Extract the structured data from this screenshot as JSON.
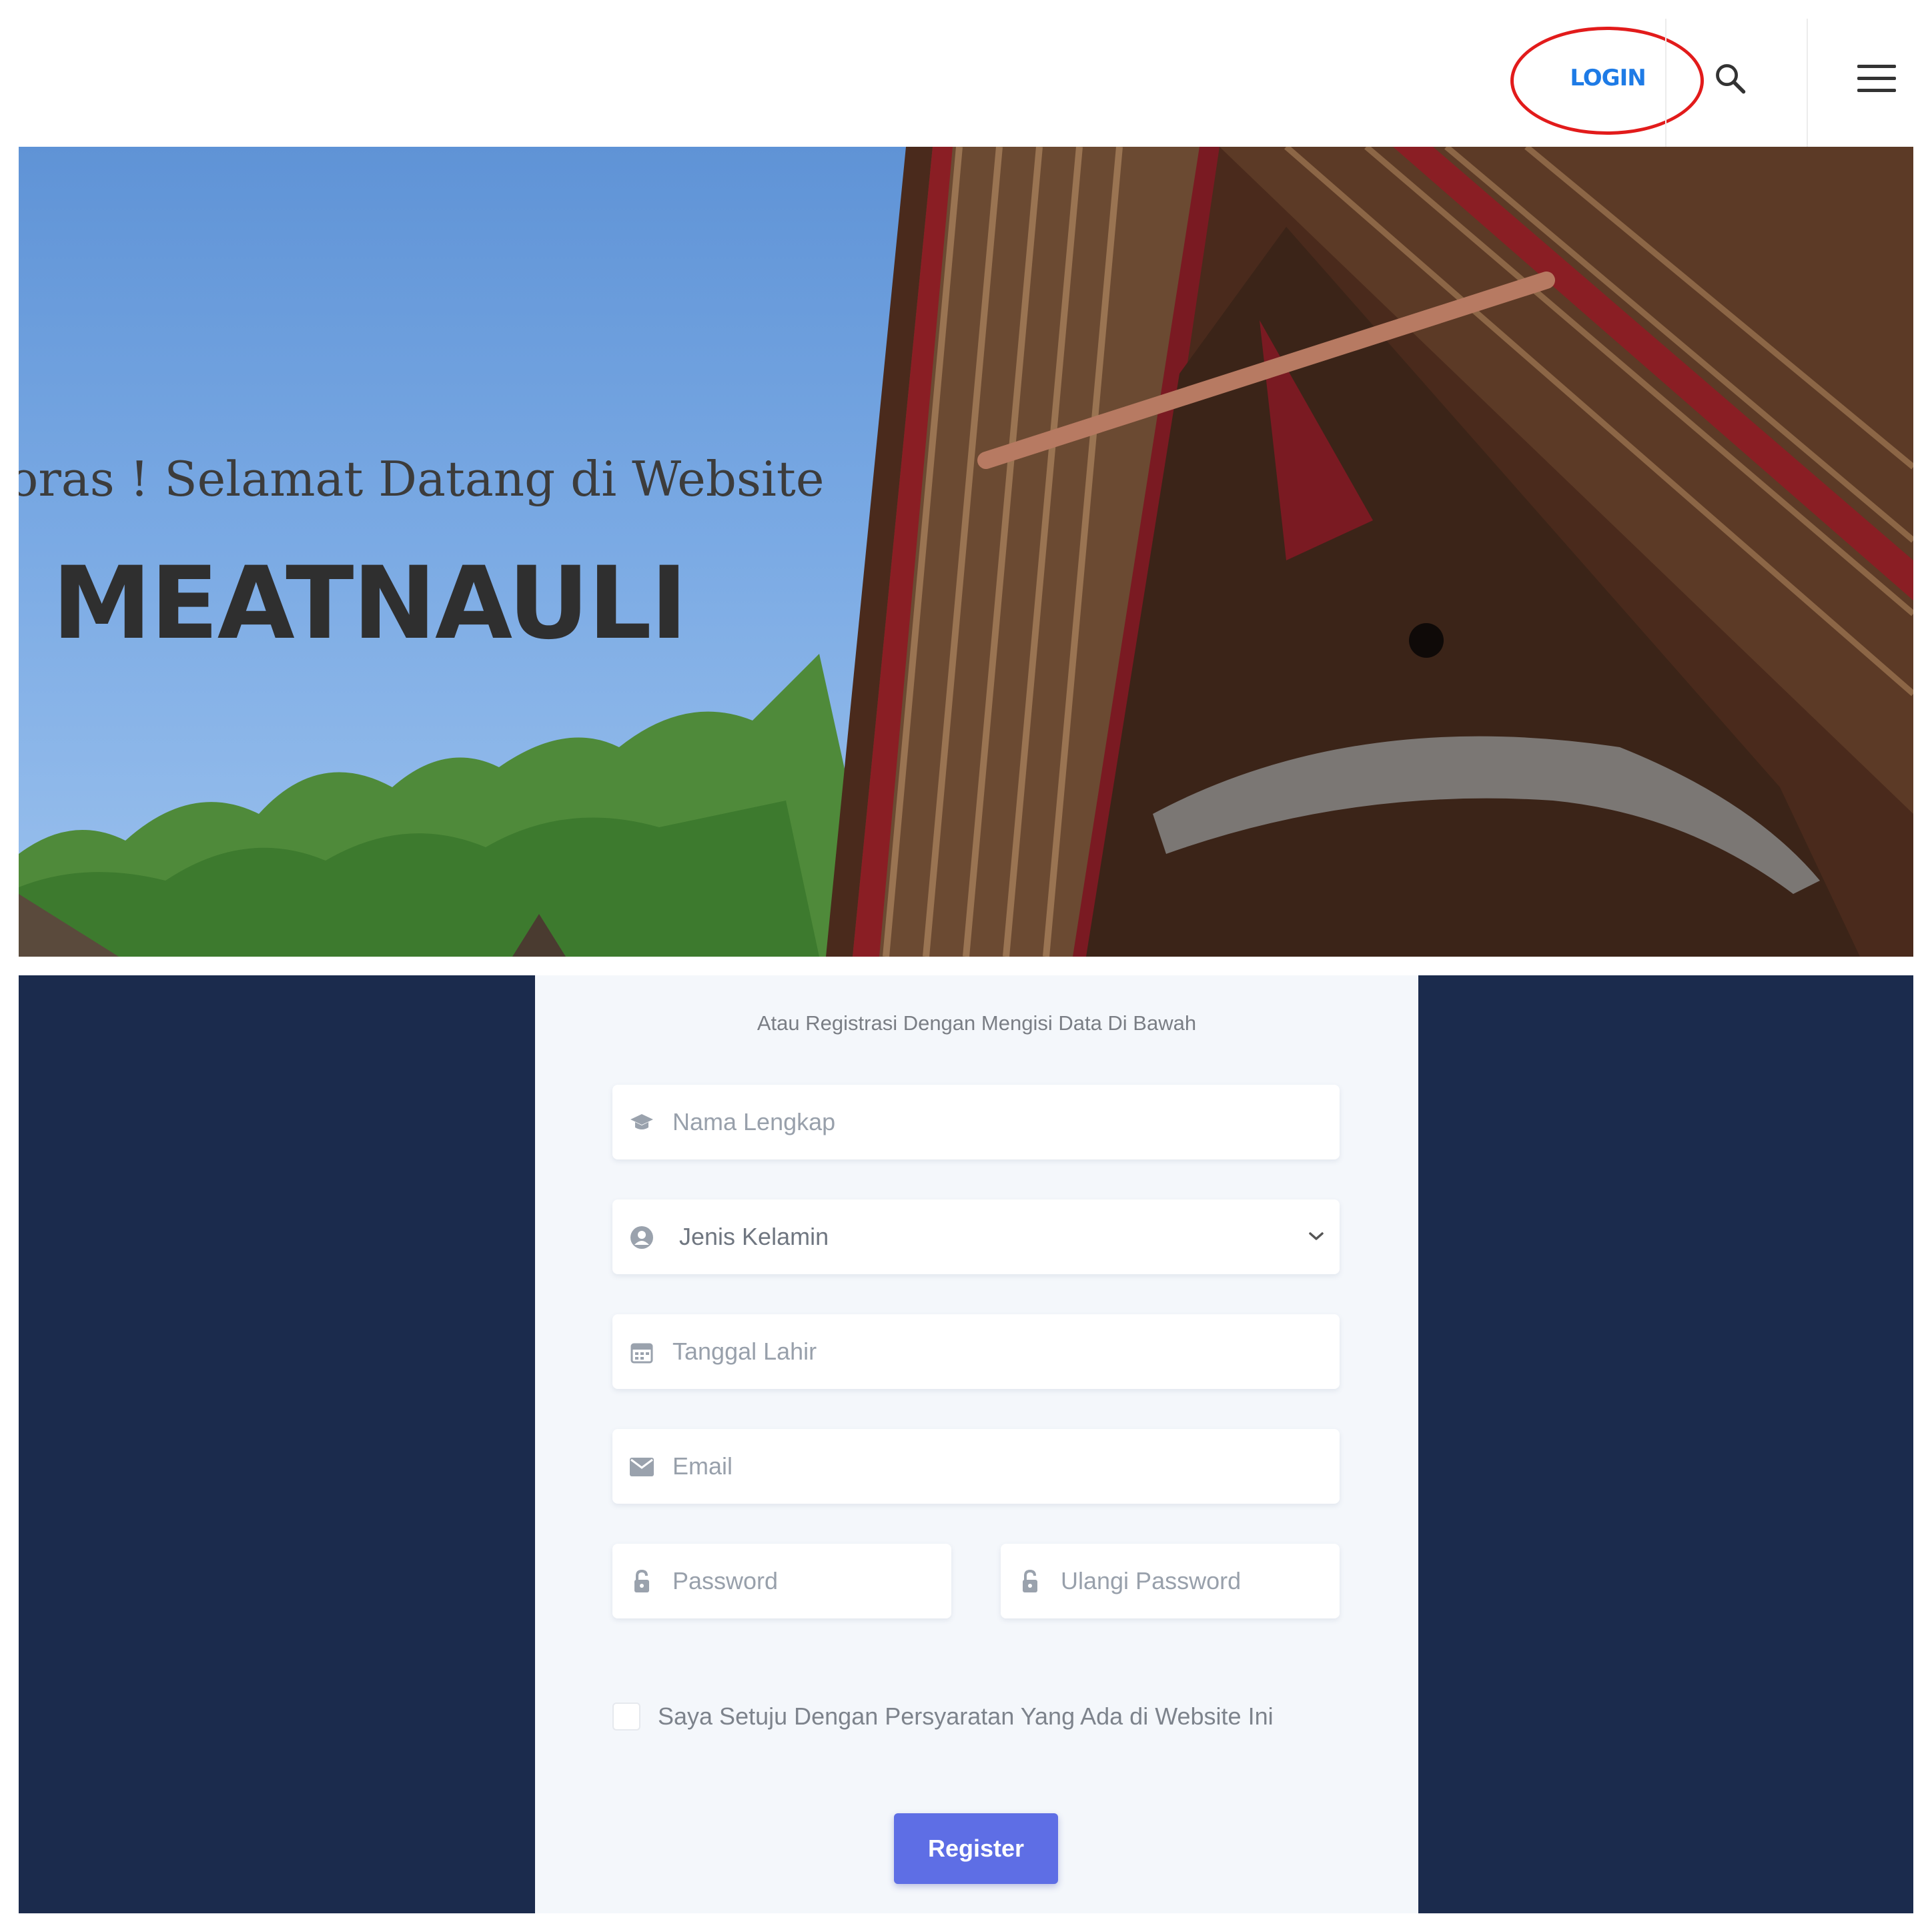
{
  "header": {
    "login_label": "LOGIN",
    "search_icon": "search-icon",
    "menu_icon": "hamburger-menu-icon",
    "annotation_color": "#e21b1b",
    "login_color": "#1e7be6"
  },
  "hero": {
    "subtitle": "oras ! Selamat Datang di Website",
    "title": "MEATNAULI",
    "background_image": "batak-traditional-house-roof"
  },
  "registration": {
    "intro": "Atau Registrasi Dengan Mengisi Data Di Bawah",
    "fields": {
      "full_name": {
        "placeholder": "Nama Lengkap",
        "icon": "graduation-cap-icon"
      },
      "gender": {
        "selected": "Jenis Kelamin",
        "icon": "user-circle-icon"
      },
      "birth_date": {
        "placeholder": "Tanggal Lahir",
        "icon": "calendar-icon"
      },
      "email": {
        "placeholder": "Email",
        "icon": "envelope-icon"
      },
      "password": {
        "placeholder": "Password",
        "icon": "lock-open-icon"
      },
      "repeat_password": {
        "placeholder": "Ulangi Password",
        "icon": "lock-open-icon"
      }
    },
    "terms_label": "Saya Setuju Dengan Persyaratan Yang Ada di Website Ini",
    "register_label": "Register",
    "colors": {
      "section_bg": "#1b2b4d",
      "panel_bg": "#f4f7fb",
      "button_bg": "#5e6ee5"
    }
  }
}
